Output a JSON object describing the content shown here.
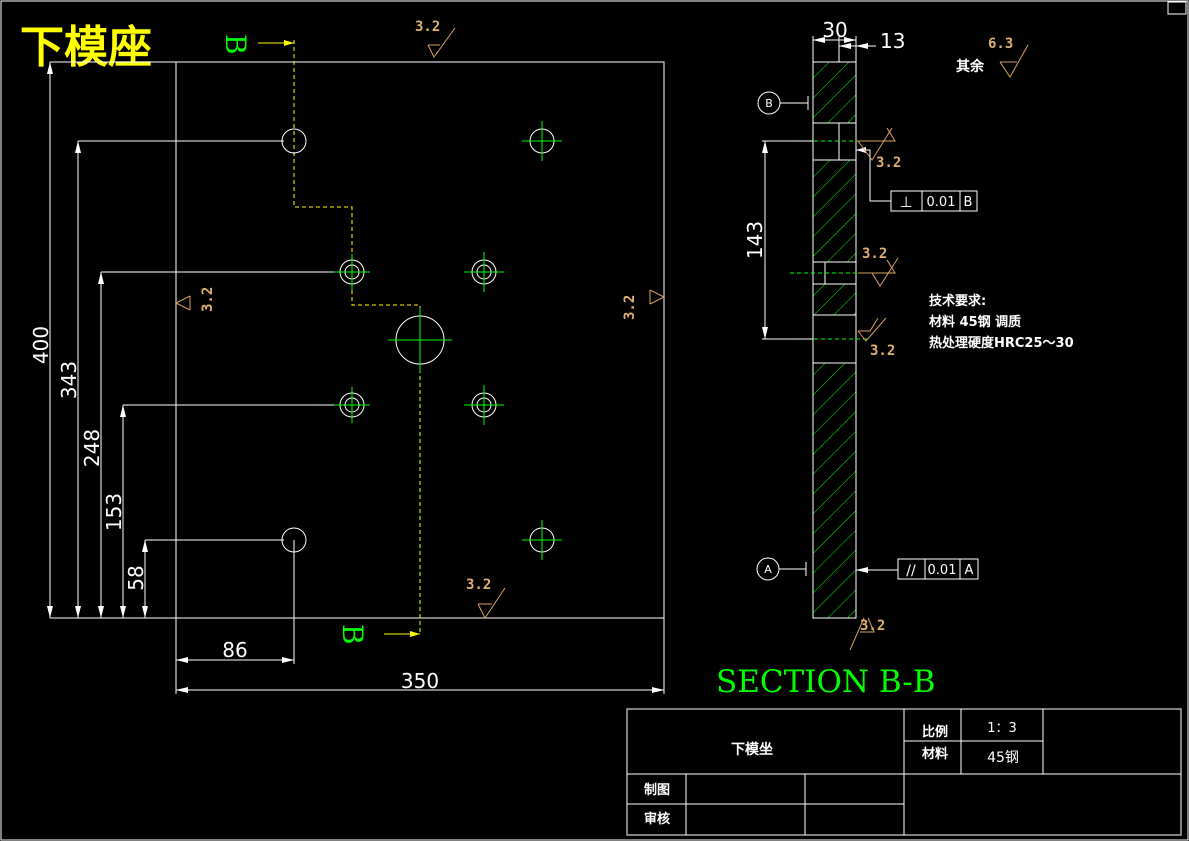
{
  "drawing_title": "下模座",
  "section_marker_top": "B",
  "section_marker_bottom": "B",
  "section_label": "SECTION B-B",
  "roughness": {
    "top": "3.2",
    "left": "3.2",
    "right": "3.2",
    "bottom": "3.2",
    "section_1": "3.2",
    "section_2": "3.2",
    "section_3": "3.2",
    "section_bottom": "3.2",
    "other": "6.3",
    "other_label": "其余"
  },
  "dimensions": {
    "height_total": "400",
    "d343": "343",
    "d248": "248",
    "d153": "153",
    "d58": "58",
    "d86": "86",
    "width_total": "350",
    "thickness": "30",
    "d13": "13",
    "d143": "143"
  },
  "datums": {
    "b": "B",
    "a": "A"
  },
  "tolerances": {
    "perpendicular": {
      "symbol": "⊥",
      "value": "0.01",
      "datum": "B"
    },
    "parallel": {
      "symbol": "//",
      "value": "0.01",
      "datum": "A"
    }
  },
  "tech_requirements": {
    "title": "技术要求:",
    "line1": "材料 45钢 调质",
    "line2": "热处理硬度HRC25～30"
  },
  "title_block": {
    "part_name": "下模坐",
    "scale_label": "比例",
    "scale_value": "1：3",
    "material_label": "材料",
    "material_value": "45钢",
    "drawn_label": "制图",
    "check_label": "审核"
  }
}
